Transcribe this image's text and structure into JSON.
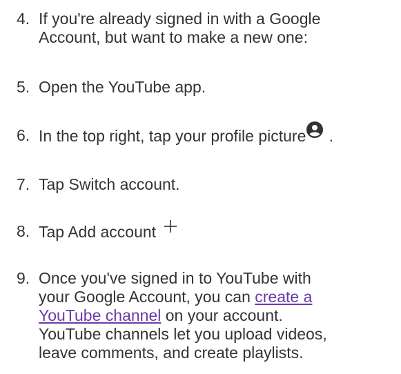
{
  "steps": [
    {
      "number": "4.",
      "lines": [
        "If you're already signed in with a Google",
        "Account, but want to make a new one:"
      ]
    },
    {
      "number": "5.",
      "lines": [
        "Open the YouTube app."
      ]
    },
    {
      "number": "6.",
      "text_before": "In the top right, tap your profile picture",
      "icon": "account-circle-icon",
      "text_after": " ."
    },
    {
      "number": "7.",
      "lines": [
        "Tap Switch account."
      ]
    },
    {
      "number": "8.",
      "text_before": "Tap Add account",
      "icon": "plus-icon"
    },
    {
      "number": "9.",
      "line1": "Once you've signed in to YouTube with",
      "line2_before": "your Google Account, you can ",
      "link_part1": "create a",
      "link_part2": "YouTube channel",
      "line3_after": " on your account.",
      "line4": "YouTube channels let you upload videos,",
      "line5": "leave comments, and create playlists."
    }
  ],
  "colors": {
    "text": "#333333",
    "link": "#6a3aa8",
    "icon": "#333333"
  }
}
